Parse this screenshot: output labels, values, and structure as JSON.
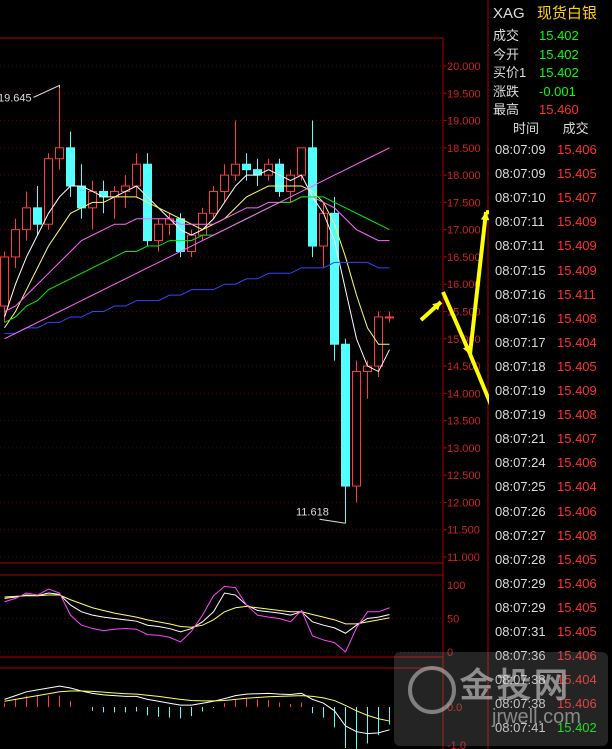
{
  "header": {
    "symbol": "XAG",
    "name": "现货白银"
  },
  "quote": [
    {
      "label": "成交",
      "value": "15.402",
      "color": "#00ff00"
    },
    {
      "label": "今开",
      "value": "15.402",
      "color": "#00ff00"
    },
    {
      "label": "买价1",
      "value": "15.402",
      "color": "#00ff00"
    },
    {
      "label": "涨跌",
      "value": "-0.001",
      "color": "#00ff00"
    },
    {
      "label": "最高",
      "value": "15.460",
      "color": "#ff3030"
    }
  ],
  "ticks_header": {
    "time": "时间",
    "price": "成交"
  },
  "ticks": [
    {
      "time": "08:07:09",
      "price": "15.406",
      "color": "#ff3030"
    },
    {
      "time": "08:07:09",
      "price": "15.405",
      "color": "#ff3030"
    },
    {
      "time": "08:07:10",
      "price": "15.407",
      "color": "#ff3030"
    },
    {
      "time": "08:07:11",
      "price": "15.409",
      "color": "#ff3030"
    },
    {
      "time": "08:07:11",
      "price": "15.409",
      "color": "#ff3030"
    },
    {
      "time": "08:07:15",
      "price": "15.409",
      "color": "#ff3030"
    },
    {
      "time": "08:07:16",
      "price": "15.411",
      "color": "#ff3030"
    },
    {
      "time": "08:07:16",
      "price": "15.408",
      "color": "#ff3030"
    },
    {
      "time": "08:07:17",
      "price": "15.404",
      "color": "#ff3030"
    },
    {
      "time": "08:07:18",
      "price": "15.405",
      "color": "#ff3030"
    },
    {
      "time": "08:07:19",
      "price": "15.409",
      "color": "#ff3030"
    },
    {
      "time": "08:07:19",
      "price": "15.408",
      "color": "#ff3030"
    },
    {
      "time": "08:07:21",
      "price": "15.407",
      "color": "#ff3030"
    },
    {
      "time": "08:07:24",
      "price": "15.406",
      "color": "#ff3030"
    },
    {
      "time": "08:07:25",
      "price": "15.404",
      "color": "#ff3030"
    },
    {
      "time": "08:07:26",
      "price": "15.406",
      "color": "#ff3030"
    },
    {
      "time": "08:07:27",
      "price": "15.408",
      "color": "#ff3030"
    },
    {
      "time": "08:07:28",
      "price": "15.405",
      "color": "#ff3030"
    },
    {
      "time": "08:07:29",
      "price": "15.406",
      "color": "#ff3030"
    },
    {
      "time": "08:07:29",
      "price": "15.405",
      "color": "#ff3030"
    },
    {
      "time": "08:07:31",
      "price": "15.405",
      "color": "#ff3030"
    },
    {
      "time": "08:07:36",
      "price": "15.406",
      "color": "#ff3030"
    },
    {
      "time": "08:07:38",
      "price": "15.404",
      "color": "#ff3030"
    },
    {
      "time": "08:07:38",
      "price": "15.406",
      "color": "#ff3030"
    },
    {
      "time": "08:07:41",
      "price": "15.402",
      "color": "#00ff00"
    }
  ],
  "watermark": {
    "text": "金投网",
    "url": "jrwell.com"
  },
  "chart_data": {
    "type": "candlestick",
    "y_axis": {
      "min": 11.0,
      "max": 20.0,
      "step": 0.5,
      "labels": [
        "20.000",
        "19.500",
        "19.000",
        "18.500",
        "18.000",
        "17.500",
        "17.000",
        "16.500",
        "16.000",
        "15.500",
        "15.000",
        "14.500",
        "14.000",
        "13.500",
        "13.000",
        "12.500",
        "12.000",
        "11.500",
        "11.000"
      ]
    },
    "annotations": {
      "high": "19.645",
      "low": "11.618"
    },
    "candles": [
      {
        "o": 15.6,
        "h": 16.6,
        "l": 15.3,
        "c": 16.5
      },
      {
        "o": 16.5,
        "h": 17.2,
        "l": 16.3,
        "c": 17.0
      },
      {
        "o": 17.0,
        "h": 17.7,
        "l": 16.8,
        "c": 17.4
      },
      {
        "o": 17.4,
        "h": 17.8,
        "l": 16.9,
        "c": 17.1
      },
      {
        "o": 17.1,
        "h": 18.4,
        "l": 17.0,
        "c": 18.3
      },
      {
        "o": 18.3,
        "h": 19.6,
        "l": 18.1,
        "c": 18.5
      },
      {
        "o": 18.5,
        "h": 18.8,
        "l": 17.6,
        "c": 17.8
      },
      {
        "o": 17.8,
        "h": 18.2,
        "l": 17.2,
        "c": 17.4
      },
      {
        "o": 17.4,
        "h": 17.9,
        "l": 17.0,
        "c": 17.7
      },
      {
        "o": 17.7,
        "h": 17.9,
        "l": 17.3,
        "c": 17.6
      },
      {
        "o": 17.6,
        "h": 17.8,
        "l": 17.2,
        "c": 17.7
      },
      {
        "o": 17.7,
        "h": 18.0,
        "l": 17.4,
        "c": 17.8
      },
      {
        "o": 17.8,
        "h": 18.4,
        "l": 17.6,
        "c": 18.2
      },
      {
        "o": 18.2,
        "h": 18.4,
        "l": 16.7,
        "c": 16.8
      },
      {
        "o": 16.8,
        "h": 17.2,
        "l": 16.6,
        "c": 17.1
      },
      {
        "o": 17.1,
        "h": 17.3,
        "l": 16.9,
        "c": 17.2
      },
      {
        "o": 17.2,
        "h": 17.3,
        "l": 16.5,
        "c": 16.6
      },
      {
        "o": 16.6,
        "h": 17.0,
        "l": 16.5,
        "c": 16.9
      },
      {
        "o": 16.9,
        "h": 17.4,
        "l": 16.8,
        "c": 17.3
      },
      {
        "o": 17.3,
        "h": 17.8,
        "l": 17.2,
        "c": 17.7
      },
      {
        "o": 17.7,
        "h": 18.2,
        "l": 17.5,
        "c": 18.0
      },
      {
        "o": 18.0,
        "h": 19.0,
        "l": 17.9,
        "c": 18.2
      },
      {
        "o": 18.2,
        "h": 18.4,
        "l": 17.9,
        "c": 18.1
      },
      {
        "o": 18.1,
        "h": 18.3,
        "l": 17.8,
        "c": 18.0
      },
      {
        "o": 18.0,
        "h": 18.3,
        "l": 17.9,
        "c": 18.2
      },
      {
        "o": 18.2,
        "h": 18.3,
        "l": 17.6,
        "c": 17.7
      },
      {
        "o": 17.7,
        "h": 18.1,
        "l": 17.5,
        "c": 18.0
      },
      {
        "o": 18.0,
        "h": 18.5,
        "l": 17.9,
        "c": 18.5
      },
      {
        "o": 18.5,
        "h": 19.0,
        "l": 16.5,
        "c": 16.7
      },
      {
        "o": 16.7,
        "h": 17.5,
        "l": 16.3,
        "c": 17.3
      },
      {
        "o": 17.3,
        "h": 17.6,
        "l": 14.6,
        "c": 14.9
      },
      {
        "o": 14.9,
        "h": 15.0,
        "l": 11.618,
        "c": 12.3
      },
      {
        "o": 12.3,
        "h": 14.6,
        "l": 12.0,
        "c": 14.4
      },
      {
        "o": 14.4,
        "h": 14.6,
        "l": 13.9,
        "c": 14.5
      },
      {
        "o": 14.5,
        "h": 15.5,
        "l": 14.3,
        "c": 15.4
      },
      {
        "o": 15.4,
        "h": 15.5,
        "l": 15.3,
        "c": 15.4
      }
    ],
    "moving_averages": [
      {
        "color": "#ffffff",
        "values": [
          15.4,
          16.0,
          16.5,
          16.9,
          17.3,
          17.6,
          17.8,
          17.8,
          17.7,
          17.6,
          17.6,
          17.7,
          17.8,
          17.6,
          17.4,
          17.2,
          17.0,
          16.9,
          17.0,
          17.2,
          17.5,
          17.8,
          18.0,
          18.0,
          18.1,
          18.0,
          17.9,
          18.0,
          17.6,
          17.3,
          16.8,
          15.9,
          15.0,
          14.5,
          14.4,
          14.8
        ]
      },
      {
        "color": "#ffff66",
        "values": [
          15.2,
          15.5,
          15.9,
          16.3,
          16.7,
          17.0,
          17.3,
          17.4,
          17.5,
          17.5,
          17.6,
          17.6,
          17.6,
          17.5,
          17.4,
          17.3,
          17.2,
          17.1,
          17.0,
          17.1,
          17.2,
          17.4,
          17.6,
          17.7,
          17.8,
          17.8,
          17.8,
          17.8,
          17.7,
          17.5,
          17.1,
          16.5,
          15.8,
          15.2,
          14.9,
          14.9
        ]
      },
      {
        "color": "#ff66ff",
        "values": [
          15.5,
          15.6,
          15.8,
          16.0,
          16.2,
          16.4,
          16.6,
          16.8,
          16.9,
          17.0,
          17.1,
          17.1,
          17.2,
          17.2,
          17.2,
          17.2,
          17.1,
          17.1,
          17.1,
          17.1,
          17.2,
          17.3,
          17.4,
          17.4,
          17.5,
          17.5,
          17.5,
          17.6,
          17.6,
          17.5,
          17.4,
          17.2,
          17.0,
          16.9,
          16.8,
          16.8
        ]
      },
      {
        "color": "#00ee00",
        "values": [
          15.3,
          15.4,
          15.6,
          15.7,
          15.9,
          16.0,
          16.1,
          16.2,
          16.3,
          16.4,
          16.5,
          16.6,
          16.6,
          16.7,
          16.7,
          16.8,
          16.8,
          16.8,
          16.9,
          16.9,
          17.0,
          17.1,
          17.2,
          17.3,
          17.4,
          17.5,
          17.5,
          17.6,
          17.6,
          17.6,
          17.5,
          17.4,
          17.3,
          17.2,
          17.1,
          17.0
        ]
      },
      {
        "color": "#3344ff",
        "values": [
          15.1,
          15.1,
          15.2,
          15.2,
          15.3,
          15.3,
          15.4,
          15.4,
          15.5,
          15.5,
          15.6,
          15.6,
          15.7,
          15.7,
          15.7,
          15.8,
          15.8,
          15.9,
          15.9,
          15.9,
          16.0,
          16.0,
          16.1,
          16.1,
          16.2,
          16.2,
          16.2,
          16.3,
          16.3,
          16.3,
          16.4,
          16.4,
          16.4,
          16.4,
          16.3,
          16.3
        ]
      },
      {
        "color": "#ff66ff",
        "values": [
          15.0,
          15.1,
          15.2,
          15.3,
          15.4,
          15.5,
          15.6,
          15.7,
          15.8,
          15.9,
          16.0,
          16.1,
          16.2,
          16.3,
          16.4,
          16.5,
          16.6,
          16.7,
          16.8,
          16.9,
          17.0,
          17.1,
          17.2,
          17.3,
          17.4,
          17.5,
          17.6,
          17.7,
          17.8,
          17.9,
          18.0,
          18.1,
          18.2,
          18.3,
          18.4,
          18.5
        ]
      }
    ],
    "kdj": {
      "y_labels": [
        "100",
        "50",
        "0"
      ],
      "k": [
        80,
        82,
        85,
        84,
        88,
        86,
        70,
        60,
        55,
        52,
        50,
        48,
        46,
        40,
        38,
        35,
        30,
        35,
        45,
        60,
        88,
        85,
        70,
        62,
        60,
        58,
        55,
        60,
        45,
        40,
        36,
        28,
        40,
        50,
        52,
        56
      ],
      "d": [
        82,
        83,
        84,
        84,
        85,
        85,
        78,
        72,
        66,
        62,
        58,
        55,
        52,
        48,
        45,
        42,
        38,
        37,
        40,
        48,
        60,
        66,
        68,
        66,
        64,
        62,
        60,
        60,
        56,
        52,
        48,
        42,
        42,
        45,
        48,
        51
      ],
      "j": [
        75,
        80,
        88,
        85,
        94,
        88,
        55,
        40,
        35,
        32,
        34,
        35,
        34,
        26,
        25,
        22,
        15,
        31,
        55,
        84,
        98,
        96,
        70,
        55,
        52,
        50,
        45,
        62,
        24,
        18,
        14,
        0,
        36,
        60,
        60,
        66
      ]
    },
    "macd": {
      "y_labels": [
        "0.0",
        "-1.0"
      ],
      "dif": [
        0.2,
        0.3,
        0.4,
        0.45,
        0.5,
        0.55,
        0.5,
        0.42,
        0.36,
        0.32,
        0.3,
        0.28,
        0.28,
        0.2,
        0.15,
        0.1,
        0.05,
        0.05,
        0.1,
        0.15,
        0.22,
        0.3,
        0.34,
        0.35,
        0.36,
        0.34,
        0.33,
        0.36,
        0.2,
        0.1,
        -0.1,
        -0.5,
        -0.65,
        -0.7,
        -0.68,
        -0.6
      ],
      "dea": [
        0.15,
        0.2,
        0.25,
        0.3,
        0.35,
        0.4,
        0.42,
        0.42,
        0.41,
        0.39,
        0.37,
        0.35,
        0.34,
        0.31,
        0.28,
        0.24,
        0.2,
        0.17,
        0.16,
        0.16,
        0.17,
        0.2,
        0.23,
        0.25,
        0.27,
        0.28,
        0.29,
        0.3,
        0.28,
        0.24,
        0.17,
        0.04,
        -0.1,
        -0.22,
        -0.31,
        -0.37
      ],
      "hist": [
        0.1,
        0.2,
        0.3,
        0.3,
        0.3,
        0.3,
        0.16,
        0.0,
        -0.1,
        -0.14,
        -0.14,
        -0.14,
        -0.12,
        -0.22,
        -0.26,
        -0.28,
        -0.3,
        -0.24,
        -0.12,
        -0.02,
        0.1,
        0.2,
        0.22,
        0.2,
        0.18,
        0.12,
        0.08,
        0.12,
        -0.16,
        -0.28,
        -0.54,
        -1.08,
        -1.1,
        -0.96,
        -0.74,
        -0.46
      ]
    }
  }
}
